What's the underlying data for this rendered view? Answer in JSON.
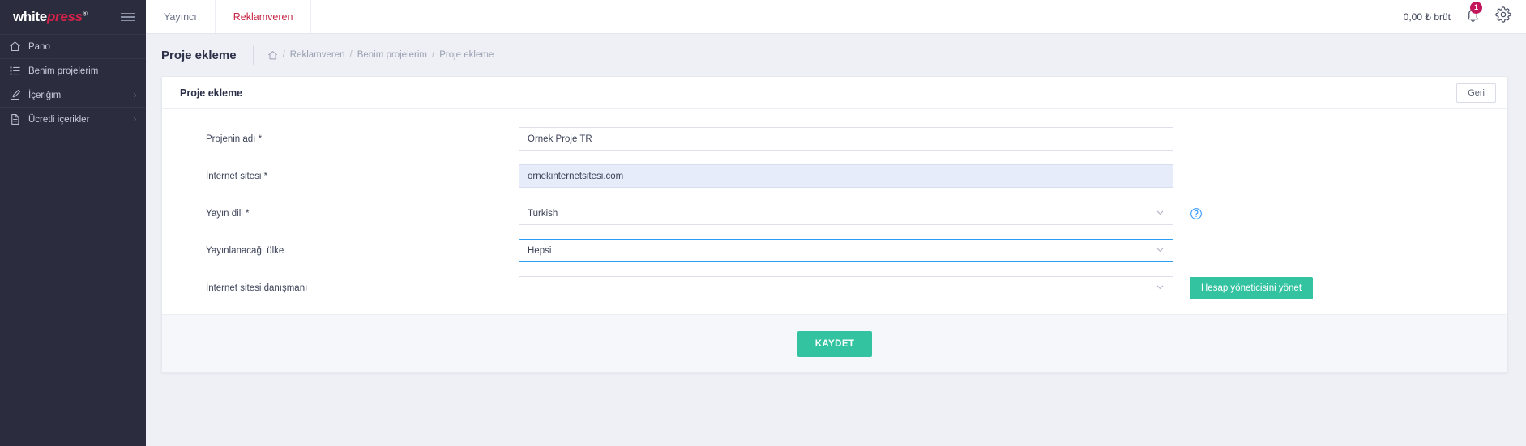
{
  "brand": {
    "name_white": "white",
    "name_accent": "press",
    "registered": "®"
  },
  "sidebar": {
    "items": [
      {
        "label": "Pano",
        "icon": "home-icon",
        "has_chevron": false
      },
      {
        "label": "Benim projelerim",
        "icon": "list-icon",
        "has_chevron": false
      },
      {
        "label": "İçeriğim",
        "icon": "edit-icon",
        "has_chevron": true
      },
      {
        "label": "Ücretli içerikler",
        "icon": "document-icon",
        "has_chevron": true
      }
    ],
    "chevron_glyph": "›"
  },
  "topbar": {
    "tabs": [
      {
        "label": "Yayıncı",
        "active": false
      },
      {
        "label": "Reklamveren",
        "active": true
      }
    ],
    "balance": "0,00 ₺ brüt",
    "notification_count": "1",
    "bell_icon": "bell-icon",
    "settings_icon": "gear-icon"
  },
  "pagehead": {
    "title": "Proje ekleme",
    "breadcrumb": {
      "home_icon": "home-icon",
      "items": [
        "Reklamveren",
        "Benim projelerim",
        "Proje ekleme"
      ],
      "separator": "/"
    }
  },
  "card": {
    "title": "Proje ekleme",
    "back_label": "Geri",
    "fields": [
      {
        "label": "Projenin adı *",
        "value": "Ornek Proje TR",
        "placeholder": "",
        "type": "text",
        "state": "normal",
        "name": "project-name"
      },
      {
        "label": "İnternet sitesi *",
        "value": "ornekinternetsitesi.com",
        "placeholder": "",
        "type": "text",
        "state": "selected",
        "name": "website"
      },
      {
        "label": "Yayın dili *",
        "value": "Turkish",
        "placeholder": "",
        "type": "select",
        "state": "normal",
        "name": "publication-language",
        "help": true
      },
      {
        "label": "Yayınlanacağı ülke",
        "value": "Hepsi",
        "placeholder": "",
        "type": "select",
        "state": "focused",
        "name": "publication-country"
      },
      {
        "label": "İnternet sitesi danışmanı",
        "value": "",
        "placeholder": "",
        "type": "select",
        "state": "normal",
        "name": "website-consultant",
        "side_button": "Hesap yöneticisini yönet"
      }
    ],
    "save_label": "KAYDET"
  },
  "colors": {
    "sidebar_bg": "#2b2d3e",
    "accent_teal": "#34c3a0",
    "accent_crimson": "#c62644",
    "brand_pink": "#d6224a",
    "focus_blue": "#2a9df4",
    "badge_red": "#c2185b"
  }
}
